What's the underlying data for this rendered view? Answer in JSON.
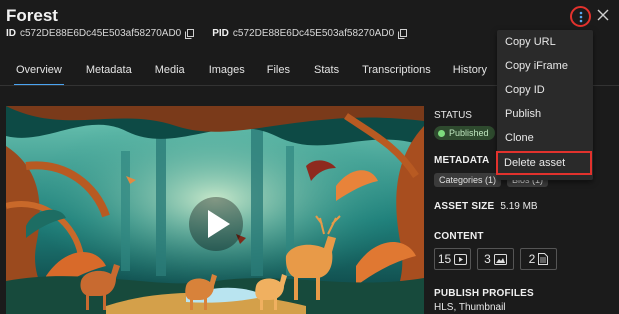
{
  "header": {
    "title": "Forest",
    "id_label": "ID",
    "id_value": "c572DE88E6Dc45E503af58270AD0",
    "pid_label": "PID",
    "pid_value": "c572DE88E6Dc45E503af58270AD0"
  },
  "tabs": [
    {
      "label": "Overview",
      "active": true
    },
    {
      "label": "Metadata"
    },
    {
      "label": "Media"
    },
    {
      "label": "Images"
    },
    {
      "label": "Files"
    },
    {
      "label": "Stats"
    },
    {
      "label": "Transcriptions"
    },
    {
      "label": "History"
    }
  ],
  "menu": {
    "items": [
      "Copy URL",
      "Copy iFrame",
      "Copy ID",
      "Publish",
      "Clone",
      "Delete asset"
    ]
  },
  "info": {
    "status_label": "STATUS",
    "status_value": "Published",
    "metadata_label": "METADATA",
    "metadata_chips": [
      "Categories (1)",
      "Bios (1)"
    ],
    "asset_size_label": "ASSET SIZE",
    "asset_size_value": "5.19 MB",
    "content_label": "CONTENT",
    "content_counts": [
      "15",
      "3",
      "2"
    ],
    "publish_profiles_label": "PUBLISH PROFILES",
    "publish_profiles_value": "HLS, Thumbnail"
  },
  "colors": {
    "accent": "#4aa3f0",
    "highlight": "#e2322d",
    "status": "#7ddc7d"
  },
  "icons": {
    "copy": "copy-icon",
    "kebab": "kebab-menu-icon",
    "close": "close-icon",
    "play": "play-icon",
    "video": "video-icon",
    "image": "image-icon",
    "document": "document-icon"
  }
}
